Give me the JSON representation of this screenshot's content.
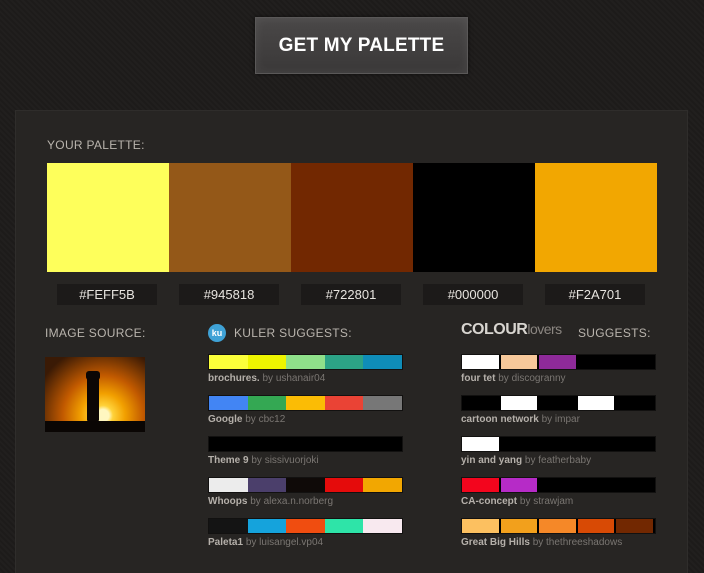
{
  "header": {
    "button_label": "GET MY PALETTE"
  },
  "palette": {
    "heading": "YOUR PALETTE:",
    "colors": [
      "#FEFF5B",
      "#945818",
      "#722801",
      "#000000",
      "#F2A701"
    ],
    "labels": [
      "#FEFF5B",
      "#945818",
      "#722801",
      "#000000",
      "#F2A701"
    ]
  },
  "image_source": {
    "heading": "IMAGE SOURCE:"
  },
  "kuler": {
    "icon_text": "ku",
    "heading": "KULER SUGGESTS:",
    "items": [
      {
        "name": "brochures.",
        "by": "by",
        "author": "ushanair04",
        "colors": [
          "#fbff3a",
          "#eef500",
          "#8fe08a",
          "#2ca386",
          "#0f8db8"
        ]
      },
      {
        "name": "Google",
        "by": "by",
        "author": "cbc12",
        "colors": [
          "#4285f4",
          "#34a853",
          "#fbbc05",
          "#ea4335",
          "#777777"
        ]
      },
      {
        "name": "Theme 9",
        "by": "by",
        "author": "sissivuorjoki",
        "colors": [
          "#000000",
          "#000000",
          "#000000",
          "#000000",
          "#000000"
        ]
      },
      {
        "name": "Whoops",
        "by": "by",
        "author": "alexa.n.norberg",
        "colors": [
          "#ececec",
          "#4b3f6b",
          "#0f0a08",
          "#e50b0b",
          "#f2a701"
        ]
      },
      {
        "name": "Paleta1",
        "by": "by",
        "author": "luisangel.vp04",
        "colors": [
          "#141414",
          "#15a3dc",
          "#f04d10",
          "#2ee4a8",
          "#f8e9ef"
        ]
      }
    ]
  },
  "colourlovers": {
    "logo_bold": "COLOUR",
    "logo_light": "lovers",
    "heading": "SUGGESTS:",
    "items": [
      {
        "name": "four tet",
        "by": "by",
        "author": "discogranny",
        "colors": [
          "#ffffff",
          "#f6c89a",
          "#8e2a99",
          "#000000",
          "#000000"
        ]
      },
      {
        "name": "cartoon network",
        "by": "by",
        "author": "impar",
        "colors": [
          "#000000",
          "#ffffff",
          "#000000",
          "#ffffff",
          "#000000"
        ]
      },
      {
        "name": "yin and yang",
        "by": "by",
        "author": "featherbaby",
        "colors": [
          "#ffffff",
          "#000000",
          "#000000",
          "#000000",
          "#000000"
        ]
      },
      {
        "name": "CA-concept",
        "by": "by",
        "author": "strawjam",
        "colors": [
          "#f3051d",
          "#b62bc7",
          "#000000",
          "#000000",
          "#000000"
        ]
      },
      {
        "name": "Great Big Hills",
        "by": "by",
        "author": "thethreeshadows",
        "colors": [
          "#fcc060",
          "#f2a01c",
          "#f58828",
          "#d84a05",
          "#722801"
        ]
      }
    ]
  }
}
